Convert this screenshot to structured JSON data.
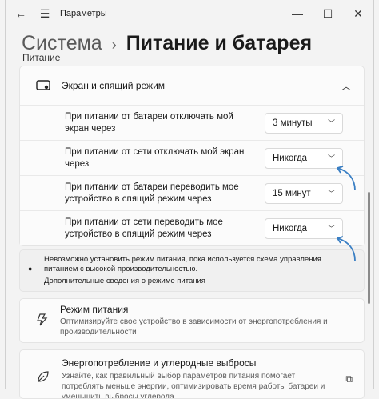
{
  "window": {
    "title": "Параметры",
    "back_icon": "←",
    "menu_icon": "☰",
    "minimize": "—",
    "maximize": "☐",
    "close": "✕"
  },
  "header": {
    "crumb1": "Система",
    "separator": "›",
    "crumb2": "Питание и батарея"
  },
  "section_label": "Питание",
  "screen_sleep": {
    "title": "Экран и спящий режим",
    "chevron": "︿",
    "rows": [
      {
        "label": "При питании от батареи отключать мой экран через",
        "value": "3 минуты"
      },
      {
        "label": "При питании от сети отключать мой экран через",
        "value": "Никогда"
      },
      {
        "label": "При питании от батареи переводить мое устройство в спящий режим через",
        "value": "15 минут"
      },
      {
        "label": "При питании от сети переводить мое устройство в спящий режим через",
        "value": "Никогда"
      }
    ],
    "dropdown_chevron": "﹀"
  },
  "note": {
    "text": "Невозможно установить режим питания, пока используется схема управления питанием с высокой производительностью.",
    "link": "Дополнительные сведения о режиме питания",
    "icon": "●"
  },
  "power_mode": {
    "title": "Режим питания",
    "description": "Оптимизируйте свое устройство в зависимости от энергопотребления и производительности"
  },
  "energy": {
    "title": "Энергопотребление и углеродные выбросы",
    "description": "Узнайте, как правильный выбор параметров питания помогает потреблять меньше энергии, оптимизировать время работы батареи и уменьшить выбросы углерода",
    "ext_icon": "⧉"
  },
  "colors": {
    "accent_arrow": "#3a7fc4"
  }
}
